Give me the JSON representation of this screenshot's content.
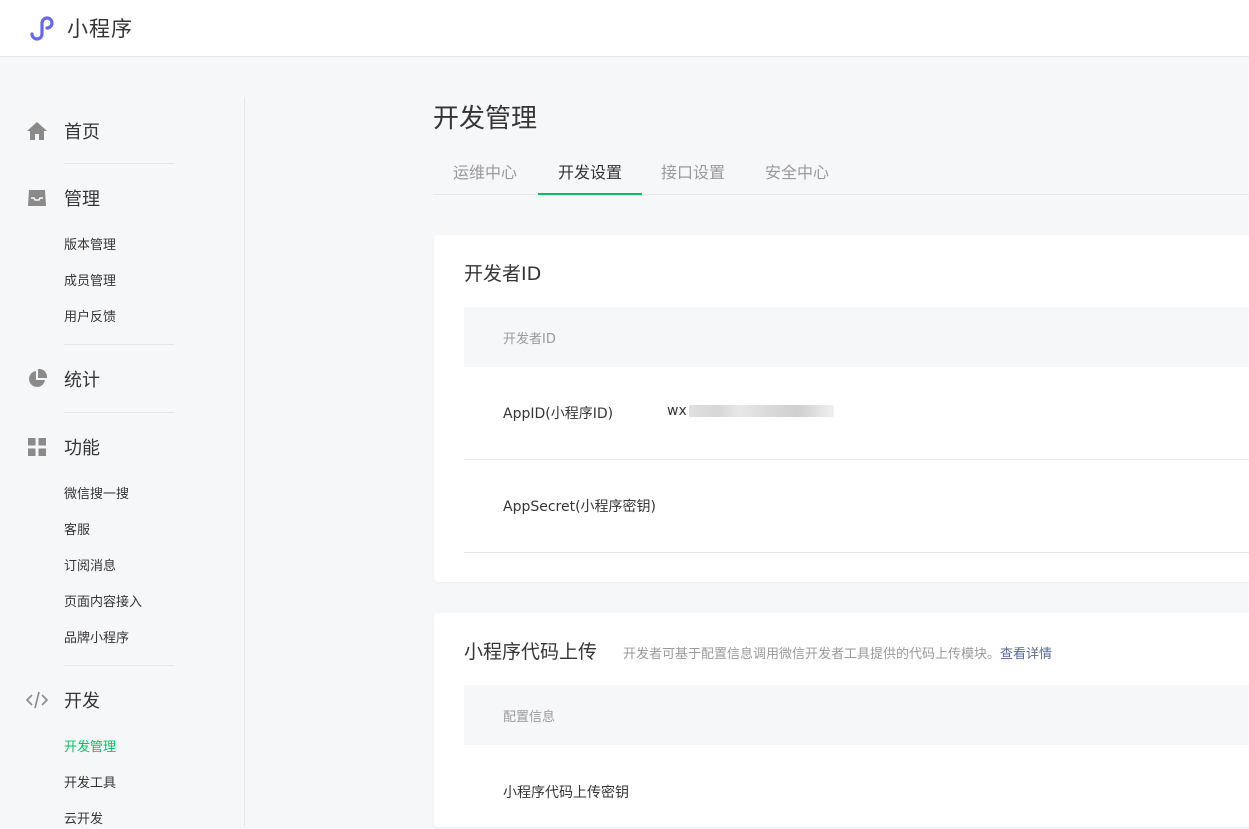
{
  "header": {
    "logo_text": "小程序",
    "logo_icon": "miniprogram-logo-icon",
    "brand_color": "#6467f0"
  },
  "sidebar": {
    "home": {
      "label": "首页",
      "icon": "home-icon"
    },
    "manage": {
      "label": "管理",
      "icon": "inbox-icon",
      "items": [
        "版本管理",
        "成员管理",
        "用户反馈"
      ]
    },
    "stats": {
      "label": "统计",
      "icon": "pie-chart-icon"
    },
    "features": {
      "label": "功能",
      "icon": "grid-icon",
      "items": [
        "微信搜一搜",
        "客服",
        "订阅消息",
        "页面内容接入",
        "品牌小程序"
      ]
    },
    "develop": {
      "label": "开发",
      "icon": "code-icon",
      "items": [
        "开发管理",
        "开发工具",
        "云开发"
      ],
      "active_item": "开发管理"
    }
  },
  "main": {
    "title": "开发管理",
    "tabs": [
      "运维中心",
      "开发设置",
      "接口设置",
      "安全中心"
    ],
    "active_tab": "开发设置",
    "developer_id_card": {
      "title": "开发者ID",
      "table_header": "开发者ID",
      "rows": [
        {
          "label": "AppID(小程序ID)",
          "value": "wx"
        },
        {
          "label": "AppSecret(小程序密钥)",
          "value": ""
        }
      ]
    },
    "upload_card": {
      "title": "小程序代码上传",
      "desc": "开发者可基于配置信息调用微信开发者工具提供的代码上传模块。",
      "desc_link": "查看详情",
      "table_header": "配置信息",
      "rows": [
        {
          "label": "小程序代码上传密钥"
        }
      ]
    }
  },
  "colors": {
    "accent": "#07c160",
    "link": "#576b95",
    "text": "#353535",
    "muted": "#9a9a9a",
    "background": "#f6f7f9"
  }
}
